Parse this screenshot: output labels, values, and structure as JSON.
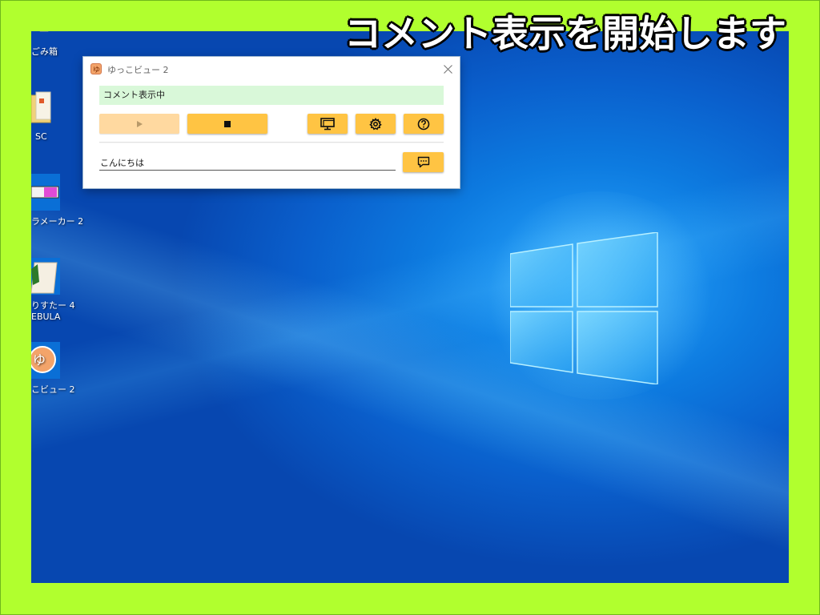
{
  "banner": {
    "text": "コメント表示を開始します"
  },
  "desktop": {
    "icons": [
      {
        "label": "ごみ箱",
        "icon": "recycle-bin-icon"
      },
      {
        "label": "SC",
        "icon": "folder-icon"
      },
      {
        "label": "ラメーカー 2",
        "icon": "app-icon"
      },
      {
        "label": "りすたー 4",
        "label2": "EBULA",
        "icon": "app-icon"
      },
      {
        "label": "こビュー 2",
        "icon": "yukkuri-view-icon"
      }
    ]
  },
  "window": {
    "title": "ゆっこビュー 2",
    "app_icon_glyph": "ゆ",
    "status": "コメント表示中",
    "comment_value": "こんにちは",
    "buttons": {
      "play": {
        "icon": "play-icon",
        "enabled": false
      },
      "stop": {
        "icon": "stop-icon",
        "enabled": true
      },
      "screen": {
        "icon": "monitor-icon"
      },
      "settings": {
        "icon": "gear-icon"
      },
      "help": {
        "icon": "help-icon"
      },
      "send": {
        "icon": "comment-send-icon"
      }
    }
  },
  "colors": {
    "border_green": "#b1ff2e",
    "button_yellow": "#ffc443",
    "button_disabled": "#ffd9a0",
    "status_green": "#d9f8d9"
  }
}
